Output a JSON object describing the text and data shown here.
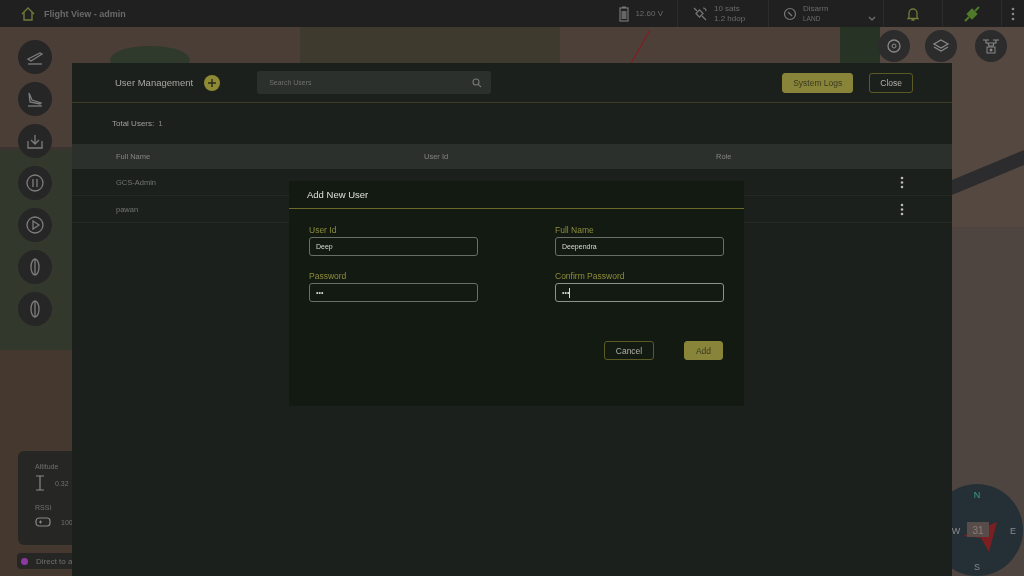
{
  "top_bar": {
    "title": "Flight View - admin",
    "battery": "12.60 V",
    "gps": {
      "sats": "10 sats",
      "hdop": "1.2 hdop"
    },
    "mode": {
      "state": "Disarm",
      "flight_mode": "LAND"
    }
  },
  "telemetry": {
    "altitude_label": "Altitude",
    "altitude": "0.32",
    "rssi_label": "RSSI",
    "rssi": "100",
    "link": {
      "label": "Direct to a",
      "color": "#8a3aa0"
    }
  },
  "compass": {
    "heading": "31",
    "n": "N",
    "e": "E",
    "s": "S",
    "w": "W"
  },
  "user_management": {
    "title": "User Management",
    "search": {
      "placeholder": "Search Users"
    },
    "buttons": [
      {
        "label": "System Logs",
        "kind": "primary"
      },
      {
        "label": "Close",
        "kind": "outline"
      }
    ],
    "total_label": "Total Users:",
    "total": "1",
    "table": {
      "columns": [
        "Full Name",
        "User Id",
        "Role"
      ],
      "rows": [
        {
          "full_name": "GCS-Admin"
        },
        {
          "full_name": "pawan"
        }
      ]
    }
  },
  "dialog": {
    "title": "Add New User",
    "fields": [
      {
        "label": "User Id",
        "value": "Deep",
        "focused": false
      },
      {
        "label": "Full Name",
        "value": "Deependra",
        "focused": false
      },
      {
        "label": "Password",
        "value": "•••",
        "focused": false
      },
      {
        "label": "Confirm Password",
        "value": "•••",
        "focused": true
      }
    ],
    "buttons": [
      {
        "label": "Cancel",
        "kind": "outline"
      },
      {
        "label": "Add",
        "kind": "primary"
      }
    ]
  }
}
